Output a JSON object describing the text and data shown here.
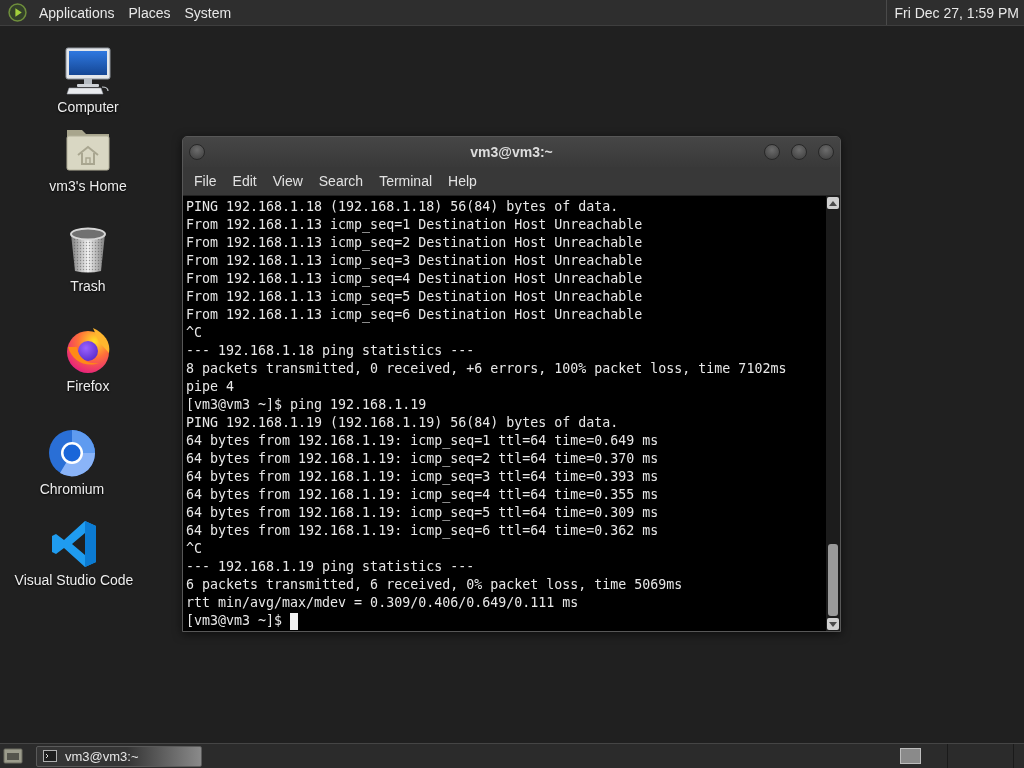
{
  "top_panel": {
    "menus": [
      "Applications",
      "Places",
      "System"
    ],
    "clock": "Fri Dec 27, 1:59 PM"
  },
  "desktop_icons": [
    {
      "label": "Computer",
      "kind": "computer"
    },
    {
      "label": "vm3's Home",
      "kind": "home"
    },
    {
      "label": "Trash",
      "kind": "trash"
    },
    {
      "label": "Firefox",
      "kind": "firefox"
    },
    {
      "label": "Chromium",
      "kind": "chromium"
    },
    {
      "label": "Visual Studio Code",
      "kind": "vscode"
    }
  ],
  "terminal": {
    "title": "vm3@vm3:~",
    "menu": [
      "File",
      "Edit",
      "View",
      "Search",
      "Terminal",
      "Help"
    ],
    "lines": [
      "PING 192.168.1.18 (192.168.1.18) 56(84) bytes of data.",
      "From 192.168.1.13 icmp_seq=1 Destination Host Unreachable",
      "From 192.168.1.13 icmp_seq=2 Destination Host Unreachable",
      "From 192.168.1.13 icmp_seq=3 Destination Host Unreachable",
      "From 192.168.1.13 icmp_seq=4 Destination Host Unreachable",
      "From 192.168.1.13 icmp_seq=5 Destination Host Unreachable",
      "From 192.168.1.13 icmp_seq=6 Destination Host Unreachable",
      "^C",
      "--- 192.168.1.18 ping statistics ---",
      "8 packets transmitted, 0 received, +6 errors, 100% packet loss, time 7102ms",
      "pipe 4",
      "[vm3@vm3 ~]$ ping 192.168.1.19",
      "PING 192.168.1.19 (192.168.1.19) 56(84) bytes of data.",
      "64 bytes from 192.168.1.19: icmp_seq=1 ttl=64 time=0.649 ms",
      "64 bytes from 192.168.1.19: icmp_seq=2 ttl=64 time=0.370 ms",
      "64 bytes from 192.168.1.19: icmp_seq=3 ttl=64 time=0.393 ms",
      "64 bytes from 192.168.1.19: icmp_seq=4 ttl=64 time=0.355 ms",
      "64 bytes from 192.168.1.19: icmp_seq=5 ttl=64 time=0.309 ms",
      "64 bytes from 192.168.1.19: icmp_seq=6 ttl=64 time=0.362 ms",
      "^C",
      "--- 192.168.1.19 ping statistics ---",
      "6 packets transmitted, 6 received, 0% packet loss, time 5069ms",
      "rtt min/avg/max/mdev = 0.309/0.406/0.649/0.111 ms"
    ],
    "prompt": "[vm3@vm3 ~]$"
  },
  "taskbar": {
    "tasks": [
      {
        "label": "vm3@vm3:~",
        "selected": true
      }
    ]
  }
}
